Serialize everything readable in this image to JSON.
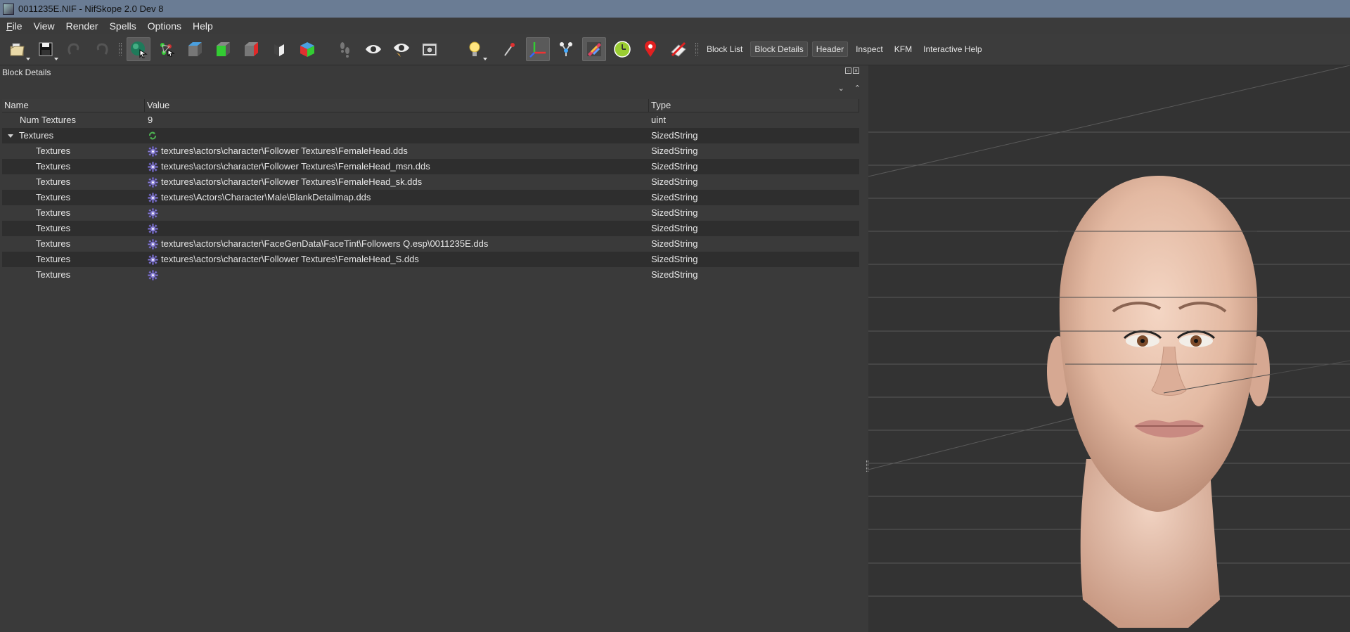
{
  "window": {
    "title": "0011235E.NIF - NifSkope 2.0 Dev 8"
  },
  "menu": [
    {
      "label": "File",
      "mnemonic": "F",
      "rest": "ile"
    },
    {
      "label": "View"
    },
    {
      "label": "Render"
    },
    {
      "label": "Spells"
    },
    {
      "label": "Options"
    },
    {
      "label": "Help"
    }
  ],
  "toolbar": {
    "icons": [
      "open-icon",
      "save-icon",
      "undo-icon",
      "redo-icon",
      "select-object-icon",
      "select-vertex-icon",
      "view-top-icon",
      "view-front-icon",
      "view-side-icon",
      "view-flip-icon",
      "view-user-icon",
      "walk-icon",
      "show-hidden-icon",
      "show-props-icon",
      "screenshot-icon",
      "light-icon",
      "pin-icon",
      "axes-icon",
      "nodes-icon",
      "texture-icon",
      "timer-icon",
      "marker-icon",
      "constraints-icon"
    ],
    "dock_buttons": [
      "Block List",
      "Block Details",
      "Header",
      "Inspect",
      "KFM",
      "Interactive Help"
    ],
    "active_dock_button": "Block Details"
  },
  "block_details": {
    "title": "Block Details",
    "columns": {
      "name": "Name",
      "value": "Value",
      "type": "Type"
    },
    "rows": [
      {
        "name": "Num Textures",
        "value": "9",
        "type": "uint",
        "level": 1,
        "icon": ""
      },
      {
        "name": "Textures",
        "value": "",
        "type": "SizedString",
        "level": 1,
        "icon": "refresh-icon",
        "expanded": true
      },
      {
        "name": "Textures",
        "value": "textures\\actors\\character\\Follower Textures\\FemaleHead.dds",
        "type": "SizedString",
        "level": 2,
        "icon": "gear-icon"
      },
      {
        "name": "Textures",
        "value": "textures\\actors\\character\\Follower Textures\\FemaleHead_msn.dds",
        "type": "SizedString",
        "level": 2,
        "icon": "gear-icon"
      },
      {
        "name": "Textures",
        "value": "textures\\actors\\character\\Follower Textures\\FemaleHead_sk.dds",
        "type": "SizedString",
        "level": 2,
        "icon": "gear-icon"
      },
      {
        "name": "Textures",
        "value": "textures\\Actors\\Character\\Male\\BlankDetailmap.dds",
        "type": "SizedString",
        "level": 2,
        "icon": "gear-icon"
      },
      {
        "name": "Textures",
        "value": "",
        "type": "SizedString",
        "level": 2,
        "icon": "gear-icon"
      },
      {
        "name": "Textures",
        "value": "",
        "type": "SizedString",
        "level": 2,
        "icon": "gear-icon"
      },
      {
        "name": "Textures",
        "value": "textures\\actors\\character\\FaceGenData\\FaceTint\\Followers Q.esp\\0011235E.dds",
        "type": "SizedString",
        "level": 2,
        "icon": "gear-icon"
      },
      {
        "name": "Textures",
        "value": "textures\\actors\\character\\Follower Textures\\FemaleHead_S.dds",
        "type": "SizedString",
        "level": 2,
        "icon": "gear-icon"
      },
      {
        "name": "Textures",
        "value": "",
        "type": "SizedString",
        "level": 2,
        "icon": "gear-icon"
      }
    ]
  },
  "viewport": {
    "content": "3D render of a bald female head mesh on a dark grid background"
  },
  "colors": {
    "titlebar": "#6a7c94",
    "panel": "#3a3a3a",
    "alt_row": "#2e2e2e",
    "viewport": "#333333"
  }
}
